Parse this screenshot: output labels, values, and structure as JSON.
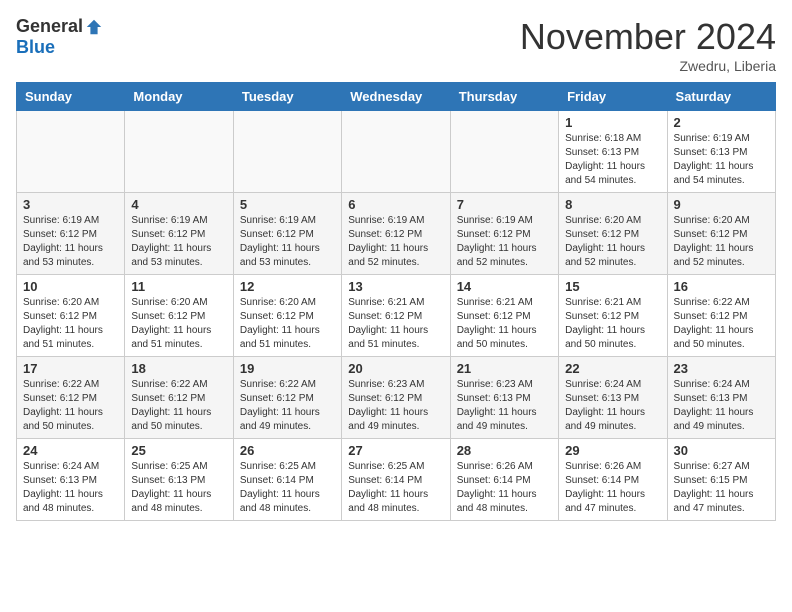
{
  "logo": {
    "general": "General",
    "blue": "Blue"
  },
  "title": "November 2024",
  "location": "Zwedru, Liberia",
  "days_of_week": [
    "Sunday",
    "Monday",
    "Tuesday",
    "Wednesday",
    "Thursday",
    "Friday",
    "Saturday"
  ],
  "weeks": [
    [
      {
        "day": "",
        "info": ""
      },
      {
        "day": "",
        "info": ""
      },
      {
        "day": "",
        "info": ""
      },
      {
        "day": "",
        "info": ""
      },
      {
        "day": "",
        "info": ""
      },
      {
        "day": "1",
        "info": "Sunrise: 6:18 AM\nSunset: 6:13 PM\nDaylight: 11 hours and 54 minutes."
      },
      {
        "day": "2",
        "info": "Sunrise: 6:19 AM\nSunset: 6:13 PM\nDaylight: 11 hours and 54 minutes."
      }
    ],
    [
      {
        "day": "3",
        "info": "Sunrise: 6:19 AM\nSunset: 6:12 PM\nDaylight: 11 hours and 53 minutes."
      },
      {
        "day": "4",
        "info": "Sunrise: 6:19 AM\nSunset: 6:12 PM\nDaylight: 11 hours and 53 minutes."
      },
      {
        "day": "5",
        "info": "Sunrise: 6:19 AM\nSunset: 6:12 PM\nDaylight: 11 hours and 53 minutes."
      },
      {
        "day": "6",
        "info": "Sunrise: 6:19 AM\nSunset: 6:12 PM\nDaylight: 11 hours and 52 minutes."
      },
      {
        "day": "7",
        "info": "Sunrise: 6:19 AM\nSunset: 6:12 PM\nDaylight: 11 hours and 52 minutes."
      },
      {
        "day": "8",
        "info": "Sunrise: 6:20 AM\nSunset: 6:12 PM\nDaylight: 11 hours and 52 minutes."
      },
      {
        "day": "9",
        "info": "Sunrise: 6:20 AM\nSunset: 6:12 PM\nDaylight: 11 hours and 52 minutes."
      }
    ],
    [
      {
        "day": "10",
        "info": "Sunrise: 6:20 AM\nSunset: 6:12 PM\nDaylight: 11 hours and 51 minutes."
      },
      {
        "day": "11",
        "info": "Sunrise: 6:20 AM\nSunset: 6:12 PM\nDaylight: 11 hours and 51 minutes."
      },
      {
        "day": "12",
        "info": "Sunrise: 6:20 AM\nSunset: 6:12 PM\nDaylight: 11 hours and 51 minutes."
      },
      {
        "day": "13",
        "info": "Sunrise: 6:21 AM\nSunset: 6:12 PM\nDaylight: 11 hours and 51 minutes."
      },
      {
        "day": "14",
        "info": "Sunrise: 6:21 AM\nSunset: 6:12 PM\nDaylight: 11 hours and 50 minutes."
      },
      {
        "day": "15",
        "info": "Sunrise: 6:21 AM\nSunset: 6:12 PM\nDaylight: 11 hours and 50 minutes."
      },
      {
        "day": "16",
        "info": "Sunrise: 6:22 AM\nSunset: 6:12 PM\nDaylight: 11 hours and 50 minutes."
      }
    ],
    [
      {
        "day": "17",
        "info": "Sunrise: 6:22 AM\nSunset: 6:12 PM\nDaylight: 11 hours and 50 minutes."
      },
      {
        "day": "18",
        "info": "Sunrise: 6:22 AM\nSunset: 6:12 PM\nDaylight: 11 hours and 50 minutes."
      },
      {
        "day": "19",
        "info": "Sunrise: 6:22 AM\nSunset: 6:12 PM\nDaylight: 11 hours and 49 minutes."
      },
      {
        "day": "20",
        "info": "Sunrise: 6:23 AM\nSunset: 6:12 PM\nDaylight: 11 hours and 49 minutes."
      },
      {
        "day": "21",
        "info": "Sunrise: 6:23 AM\nSunset: 6:13 PM\nDaylight: 11 hours and 49 minutes."
      },
      {
        "day": "22",
        "info": "Sunrise: 6:24 AM\nSunset: 6:13 PM\nDaylight: 11 hours and 49 minutes."
      },
      {
        "day": "23",
        "info": "Sunrise: 6:24 AM\nSunset: 6:13 PM\nDaylight: 11 hours and 49 minutes."
      }
    ],
    [
      {
        "day": "24",
        "info": "Sunrise: 6:24 AM\nSunset: 6:13 PM\nDaylight: 11 hours and 48 minutes."
      },
      {
        "day": "25",
        "info": "Sunrise: 6:25 AM\nSunset: 6:13 PM\nDaylight: 11 hours and 48 minutes."
      },
      {
        "day": "26",
        "info": "Sunrise: 6:25 AM\nSunset: 6:14 PM\nDaylight: 11 hours and 48 minutes."
      },
      {
        "day": "27",
        "info": "Sunrise: 6:25 AM\nSunset: 6:14 PM\nDaylight: 11 hours and 48 minutes."
      },
      {
        "day": "28",
        "info": "Sunrise: 6:26 AM\nSunset: 6:14 PM\nDaylight: 11 hours and 48 minutes."
      },
      {
        "day": "29",
        "info": "Sunrise: 6:26 AM\nSunset: 6:14 PM\nDaylight: 11 hours and 47 minutes."
      },
      {
        "day": "30",
        "info": "Sunrise: 6:27 AM\nSunset: 6:15 PM\nDaylight: 11 hours and 47 minutes."
      }
    ]
  ]
}
